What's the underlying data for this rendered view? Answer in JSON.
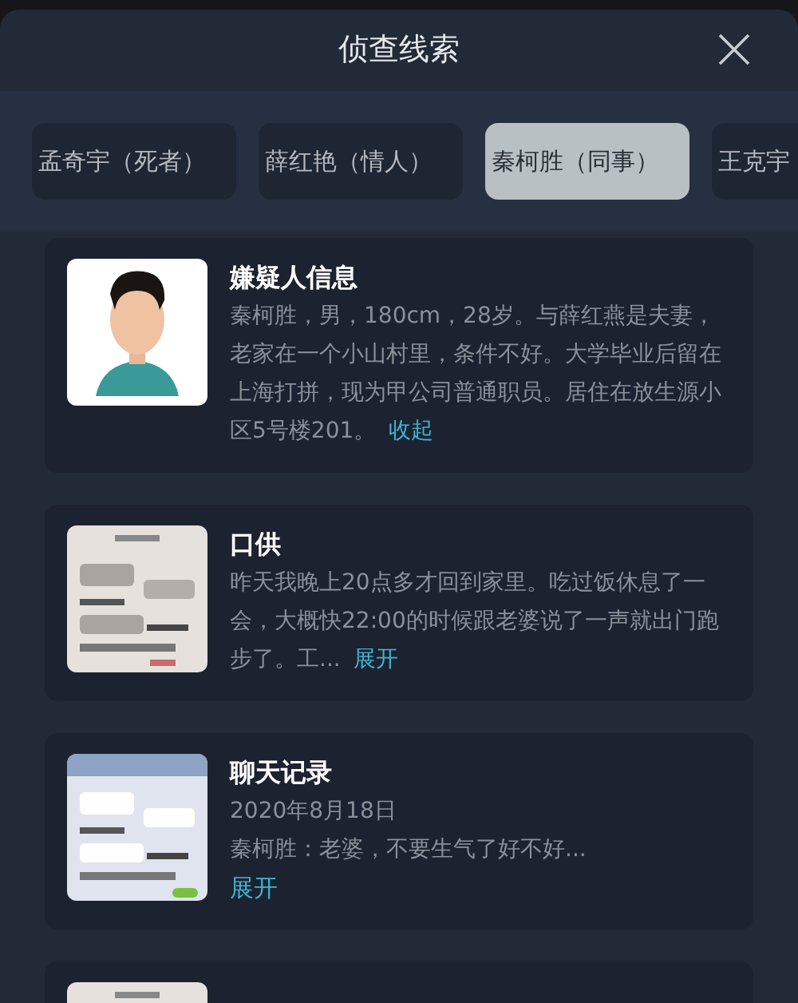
{
  "dialog": {
    "title": "侦查线索"
  },
  "tabs": [
    {
      "label": "孟奇宇（死者）",
      "selected": false
    },
    {
      "label": "薛红艳（情人）",
      "selected": false
    },
    {
      "label": "秦柯胜（同事）",
      "selected": true
    },
    {
      "label": "王克宇",
      "selected": false
    }
  ],
  "cards": [
    {
      "thumbnail": {
        "kind": "avatar"
      },
      "title": "嫌疑人信息",
      "lines": [
        "秦柯胜，男，180cm，28岁。与薛红燕是夫妻，老家在一个小山村里，条件不好。大学毕业后留在上海打拼，现为甲公司普通职员。居住在放生源小区5号楼201。"
      ],
      "link": "收起",
      "link_inline": true
    },
    {
      "thumbnail": {
        "kind": "document"
      },
      "title": "口供",
      "lines": [
        "昨天我晚上20点多才回到家里。吃过饭休息了一会，大概快22:00的时候跟老婆说了一声就出门跑步了。工..."
      ],
      "link": "展开",
      "link_inline": true
    },
    {
      "thumbnail": {
        "kind": "chat"
      },
      "title": "聊天记录",
      "lines": [
        "2020年8月18日",
        "秦柯胜：老婆，不要生气了好不好..."
      ],
      "link": "展开",
      "link_inline": false
    },
    {
      "thumbnail": {
        "kind": "document"
      }
    }
  ]
}
